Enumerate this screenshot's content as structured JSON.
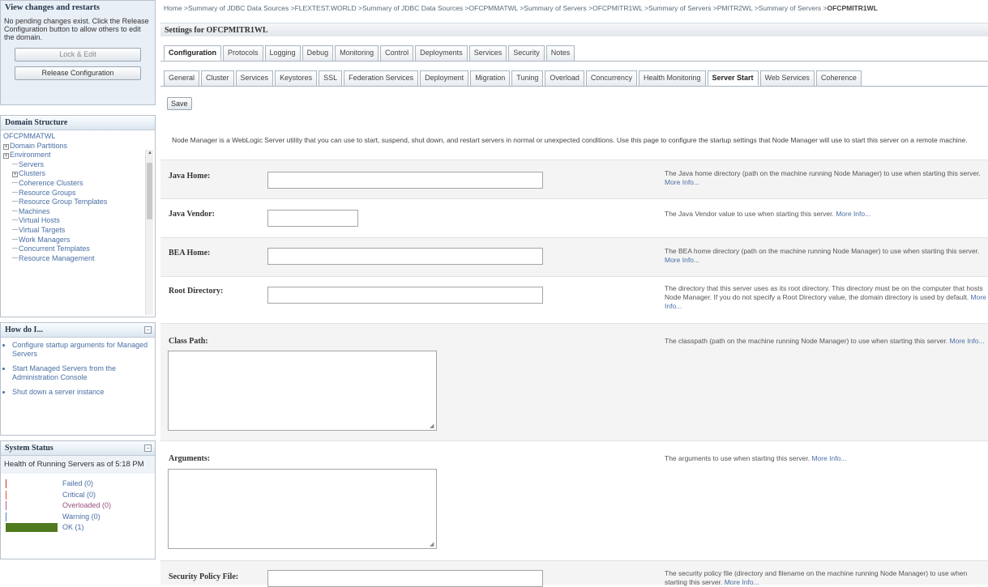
{
  "change_center": {
    "title": "View changes and restarts",
    "message": "No pending changes exist. Click the Release Configuration button to allow others to edit the domain.",
    "lock_edit_label": "Lock & Edit",
    "release_label": "Release Configuration"
  },
  "domain_structure": {
    "title": "Domain Structure",
    "root": "OFCPMMATWL",
    "items": [
      {
        "label": "Domain Partitions",
        "level": 1,
        "expandable": true
      },
      {
        "label": "Environment",
        "level": 1,
        "expandable": true
      },
      {
        "label": "Servers",
        "level": 2,
        "expandable": false
      },
      {
        "label": "Clusters",
        "level": 2,
        "expandable": true
      },
      {
        "label": "Coherence Clusters",
        "level": 2,
        "expandable": false
      },
      {
        "label": "Resource Groups",
        "level": 2,
        "expandable": false
      },
      {
        "label": "Resource Group Templates",
        "level": 2,
        "expandable": false
      },
      {
        "label": "Machines",
        "level": 2,
        "expandable": false
      },
      {
        "label": "Virtual Hosts",
        "level": 2,
        "expandable": false
      },
      {
        "label": "Virtual Targets",
        "level": 2,
        "expandable": false
      },
      {
        "label": "Work Managers",
        "level": 2,
        "expandable": false
      },
      {
        "label": "Concurrent Templates",
        "level": 2,
        "expandable": false
      },
      {
        "label": "Resource Management",
        "level": 2,
        "expandable": false
      }
    ]
  },
  "how_do_i": {
    "title": "How do I...",
    "items": [
      "Configure startup arguments for Managed Servers",
      "Start Managed Servers from the Administration Console",
      "Shut down a server instance"
    ]
  },
  "system_status": {
    "title": "System Status",
    "health_label": "Health of Running Servers as of  5:18 PM",
    "rows": [
      {
        "label": "Failed (0)",
        "color": "#c0392b",
        "fill": 0
      },
      {
        "label": "Critical (0)",
        "color": "#e74c3c",
        "fill": 0
      },
      {
        "label": "Overloaded (0)",
        "color": "#b35c8f",
        "fill": 0
      },
      {
        "label": "Warning (0)",
        "color": "#4a7fc1",
        "fill": 0
      },
      {
        "label": "OK (1)",
        "color": "#4f7a1e",
        "fill": 1
      }
    ]
  },
  "breadcrumb": {
    "items": [
      "Home",
      "Summary of JDBC Data Sources",
      "FLEXTEST.WORLD",
      "Summary of JDBC Data Sources",
      "OFCPMMATWL",
      "Summary of Servers",
      "OFCPMITR1WL",
      "Summary of Servers",
      "PMITR2WL",
      "Summary of Servers"
    ],
    "current": "OFCPMITR1WL"
  },
  "settings_title": "Settings for OFCPMITR1WL",
  "tabs_primary": [
    {
      "label": "Configuration",
      "active": true
    },
    {
      "label": "Protocols",
      "active": false
    },
    {
      "label": "Logging",
      "active": false
    },
    {
      "label": "Debug",
      "active": false
    },
    {
      "label": "Monitoring",
      "active": false
    },
    {
      "label": "Control",
      "active": false
    },
    {
      "label": "Deployments",
      "active": false
    },
    {
      "label": "Services",
      "active": false
    },
    {
      "label": "Security",
      "active": false
    },
    {
      "label": "Notes",
      "active": false
    }
  ],
  "tabs_secondary": [
    {
      "label": "General",
      "active": false
    },
    {
      "label": "Cluster",
      "active": false
    },
    {
      "label": "Services",
      "active": false
    },
    {
      "label": "Keystores",
      "active": false
    },
    {
      "label": "SSL",
      "active": false
    },
    {
      "label": "Federation Services",
      "active": false
    },
    {
      "label": "Deployment",
      "active": false
    },
    {
      "label": "Migration",
      "active": false
    },
    {
      "label": "Tuning",
      "active": false
    },
    {
      "label": "Overload",
      "active": false
    },
    {
      "label": "Concurrency",
      "active": false
    },
    {
      "label": "Health Monitoring",
      "active": false
    },
    {
      "label": "Server Start",
      "active": true
    },
    {
      "label": "Web Services",
      "active": false
    },
    {
      "label": "Coherence",
      "active": false
    }
  ],
  "save_label": "Save",
  "intro": "Node Manager is a WebLogic Server utility that you can use to start, suspend, shut down, and restart servers in normal or unexpected conditions. Use this page to configure the startup settings that Node Manager will use to start this server on a remote machine.",
  "fields": [
    {
      "id": "java-home",
      "label": "Java Home:",
      "type": "input",
      "width": "wide",
      "value": "",
      "help": "The Java home directory (path on the machine running Node Manager) to use when starting this server.",
      "more": "More Info..."
    },
    {
      "id": "java-vendor",
      "label": "Java Vendor:",
      "type": "input",
      "width": "narrow",
      "value": "",
      "help": "The Java Vendor value to use when starting this server.",
      "more": "More Info..."
    },
    {
      "id": "bea-home",
      "label": "BEA Home:",
      "type": "input",
      "width": "wide",
      "value": "",
      "help": "The BEA home directory (path on the machine running Node Manager) to use when starting this server.",
      "more": "More Info..."
    },
    {
      "id": "root-directory",
      "label": "Root Directory:",
      "type": "input",
      "width": "wide",
      "value": "",
      "help": "The directory that this server uses as its root directory. This directory must be on the computer that hosts Node Manager. If you do not specify a Root Directory value, the domain directory is used by default.",
      "more": "More Info..."
    },
    {
      "id": "class-path",
      "label": "Class Path:",
      "type": "textarea",
      "value": "",
      "help": "The classpath (path on the machine running Node Manager) to use when starting this server.",
      "more": "More Info..."
    },
    {
      "id": "arguments",
      "label": "Arguments:",
      "type": "textarea",
      "value": "",
      "help": "The arguments to use when starting this server.",
      "more": "More Info..."
    },
    {
      "id": "security-policy-file",
      "label": "Security Policy File:",
      "type": "input",
      "width": "wide",
      "value": "",
      "help": "The security policy file (directory and filename on the machine running Node Manager) to use when starting this server.",
      "more": "More Info..."
    }
  ]
}
